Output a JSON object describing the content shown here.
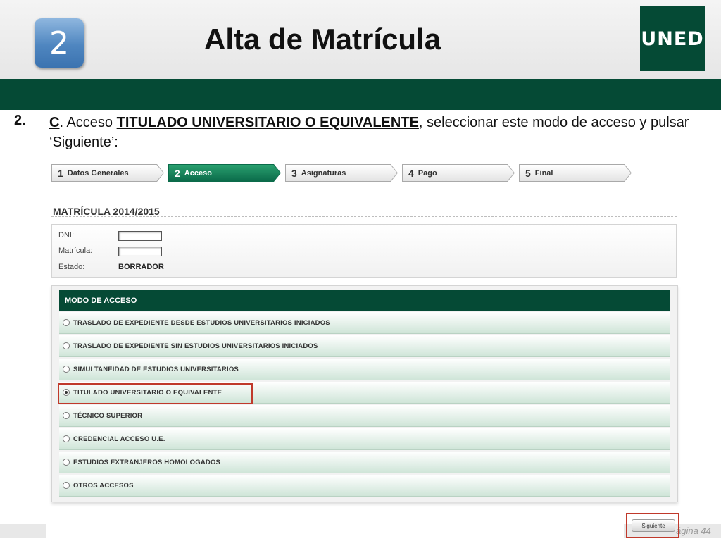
{
  "header": {
    "step_number": "2",
    "title": "Alta de Matrícula",
    "logo_text": "UNED"
  },
  "instruction": {
    "number": "2.",
    "letter": "C",
    "text_a": ". Acceso ",
    "access_name": "TITULADO UNIVERSITARIO O EQUIVALENTE",
    "text_b": ", seleccionar este modo de acceso y pulsar ‘Siguiente’:"
  },
  "wizard": {
    "steps": [
      {
        "n": "1",
        "label": "Datos Generales"
      },
      {
        "n": "2",
        "label": "Acceso"
      },
      {
        "n": "3",
        "label": "Asignaturas"
      },
      {
        "n": "4",
        "label": "Pago"
      },
      {
        "n": "5",
        "label": "Final"
      }
    ],
    "active_index": 1
  },
  "enrollment": {
    "title": "MATRÍCULA 2014/2015",
    "dni_label": "DNI:",
    "dni_value": "",
    "matricula_label": "Matrícula:",
    "matricula_value": "",
    "estado_label": "Estado:",
    "estado_value": "BORRADOR"
  },
  "access_mode": {
    "header": "MODO DE ACCESO",
    "options": [
      "TRASLADO DE EXPEDIENTE DESDE ESTUDIOS UNIVERSITARIOS INICIADOS",
      "TRASLADO DE EXPEDIENTE SIN ESTUDIOS UNIVERSITARIOS INICIADOS",
      "SIMULTANEIDAD DE ESTUDIOS UNIVERSITARIOS",
      "TITULADO UNIVERSITARIO O EQUIVALENTE",
      "TÉCNICO SUPERIOR",
      "CREDENCIAL ACCESO U.E.",
      "ESTUDIOS EXTRANJEROS HOMOLOGADOS",
      "OTROS ACCESOS"
    ],
    "selected_index": 3
  },
  "footer": {
    "next_button": "Siguiente",
    "page_label": "ágina 44"
  },
  "colors": {
    "brand_green": "#054a35",
    "highlight_red": "#c0392b",
    "badge_blue": "#4f86c0"
  }
}
